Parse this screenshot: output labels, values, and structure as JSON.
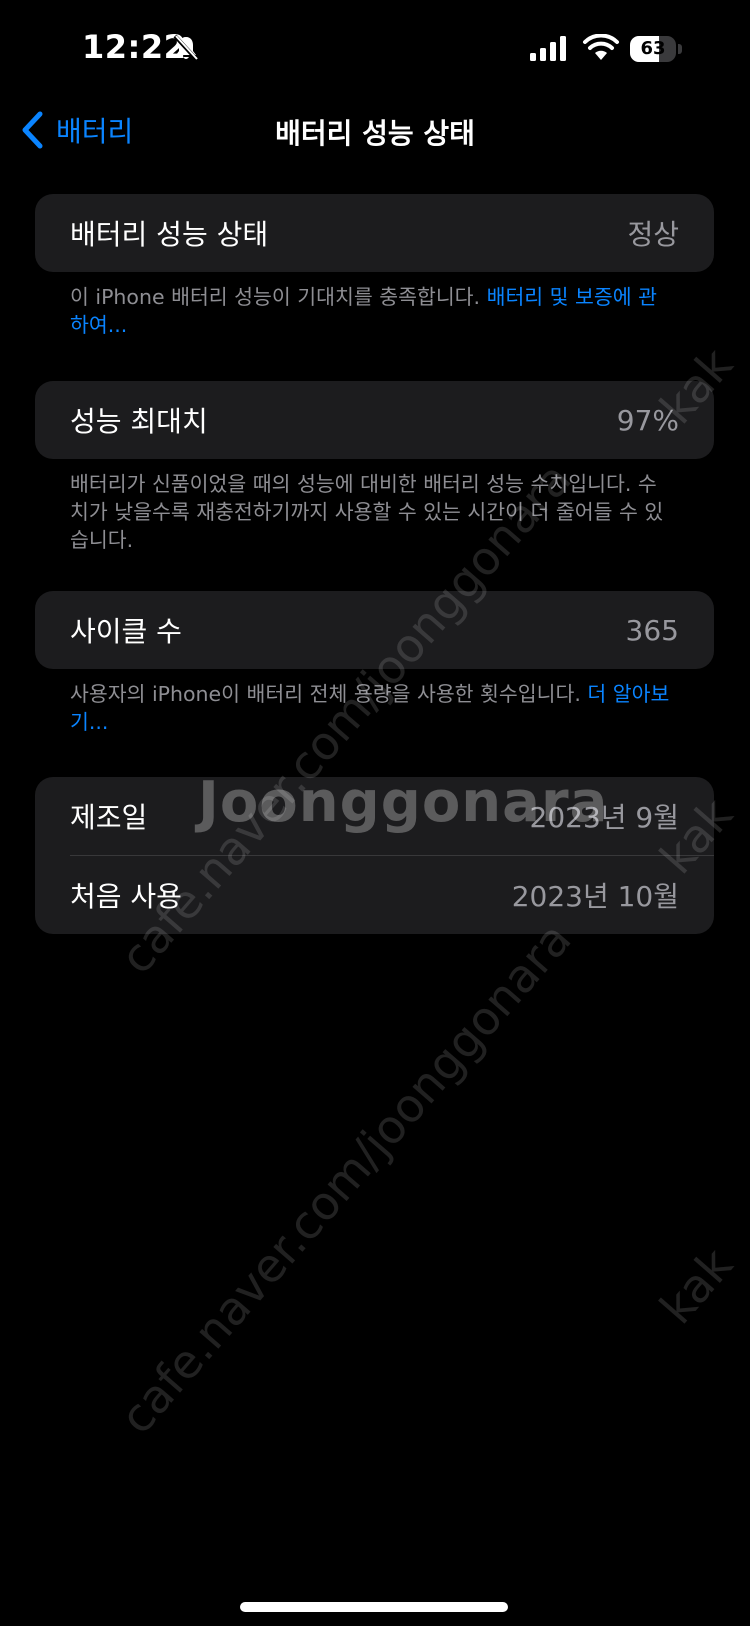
{
  "status_bar": {
    "time": "12:22",
    "battery_level": "63",
    "battery_fraction": 0.63,
    "icons": [
      "bell-slash-icon",
      "cellular-signal-icon",
      "wifi-icon",
      "battery-icon"
    ]
  },
  "nav": {
    "back_label": "배터리",
    "title": "배터리 성능 상태"
  },
  "battery_health": {
    "label": "배터리 성능 상태",
    "value": "정상",
    "note": "이 iPhone 배터리 성능이 기대치를 충족합니다. ",
    "note_link": "배터리 및 보증에 관하여..."
  },
  "max_capacity": {
    "label": "성능 최대치",
    "value": "97%",
    "note": "배터리가 신품이었을 때의 성능에 대비한 배터리 성능 수치입니다. 수치가 낮을수록 재충전하기까지 사용할 수 있는 시간이 더 줄어들 수 있습니다."
  },
  "cycle_count": {
    "label": "사이클 수",
    "value": "365",
    "note": "사용자의 iPhone이 배터리 전체 용량을 사용한 횟수입니다. ",
    "note_link": "더 알아보기..."
  },
  "dates": {
    "manufacture_label": "제조일",
    "manufacture_value": "2023년 9월",
    "first_use_label": "처음 사용",
    "first_use_value": "2023년 10월"
  },
  "watermarks": {
    "url": "cafe.naver.com/joonggonara",
    "brand": "Joonggonara",
    "edge": "kak"
  },
  "colors": {
    "accent": "#0a84ff",
    "background": "#000000",
    "card": "#1c1c1e",
    "secondary_text": "#8e8e93"
  }
}
